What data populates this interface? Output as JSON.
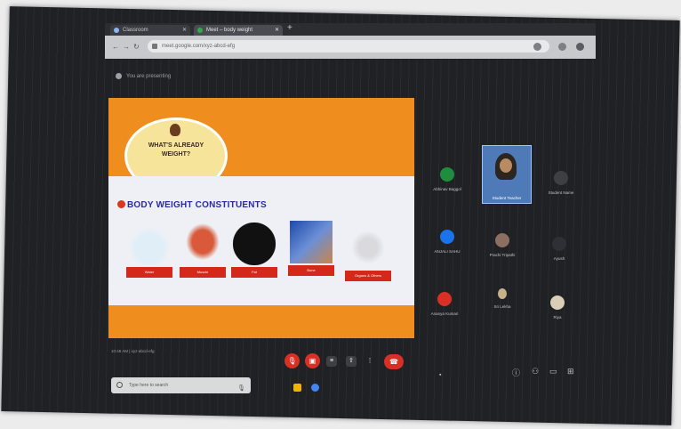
{
  "browser": {
    "tabs": [
      {
        "label": "Classroom"
      },
      {
        "label": "Meet – body weight"
      }
    ],
    "new_tab_icon": "plus-icon",
    "url": "meet.google.com/xyz-abcd-efg",
    "controls": [
      "back-icon",
      "forward-icon",
      "reload-icon"
    ]
  },
  "meet": {
    "presenting_text": "You are presenting",
    "meeting_info": "10:45 AM  |  xyz-abcd-efg"
  },
  "slide": {
    "title": "WHAT'S ALREADY WEIGHT?",
    "subtitle": "BODY WEIGHT CONSTITUENTS",
    "constituents": [
      {
        "label": "Water",
        "image": "water-figure"
      },
      {
        "label": "Muscle",
        "image": "muscle-figure"
      },
      {
        "label": "Fat",
        "image": "fat-image"
      },
      {
        "label": "Bone",
        "image": "bone-image"
      },
      {
        "label": "Organs & Others",
        "image": "skeleton-figure"
      }
    ],
    "colors": {
      "orange": "#f08d1f",
      "white_panel": "#eef0f6",
      "label_red": "#d4281b",
      "subtitle_blue": "#2a2aa8"
    }
  },
  "participants": [
    {
      "name": "Abhinav Baggol",
      "color": "#1e8e3e"
    },
    {
      "name": "Student Teacher",
      "featured": true
    },
    {
      "name": "Student Name",
      "color": "#5f6368"
    },
    {
      "name": "ANJALI SAHU",
      "color": "#1a73e8"
    },
    {
      "name": "Prachi Tripathi",
      "color": "#8d6e63"
    },
    {
      "name": "Ayush",
      "color": "#5f6368"
    },
    {
      "name": "Ananya Kumari",
      "color": "#d93025"
    },
    {
      "name": "Sri Lekha",
      "color": "#c7b28a"
    },
    {
      "name": "Riya",
      "color": "#d9cfb8"
    }
  ],
  "controls": {
    "mic": "mic-off-icon",
    "camera": "camera-off-icon",
    "captions": "captions-icon",
    "present": "present-icon",
    "more": "more-icon",
    "end_call": "end-call-icon"
  },
  "taskbar": {
    "search_placeholder": "Type here to search"
  }
}
